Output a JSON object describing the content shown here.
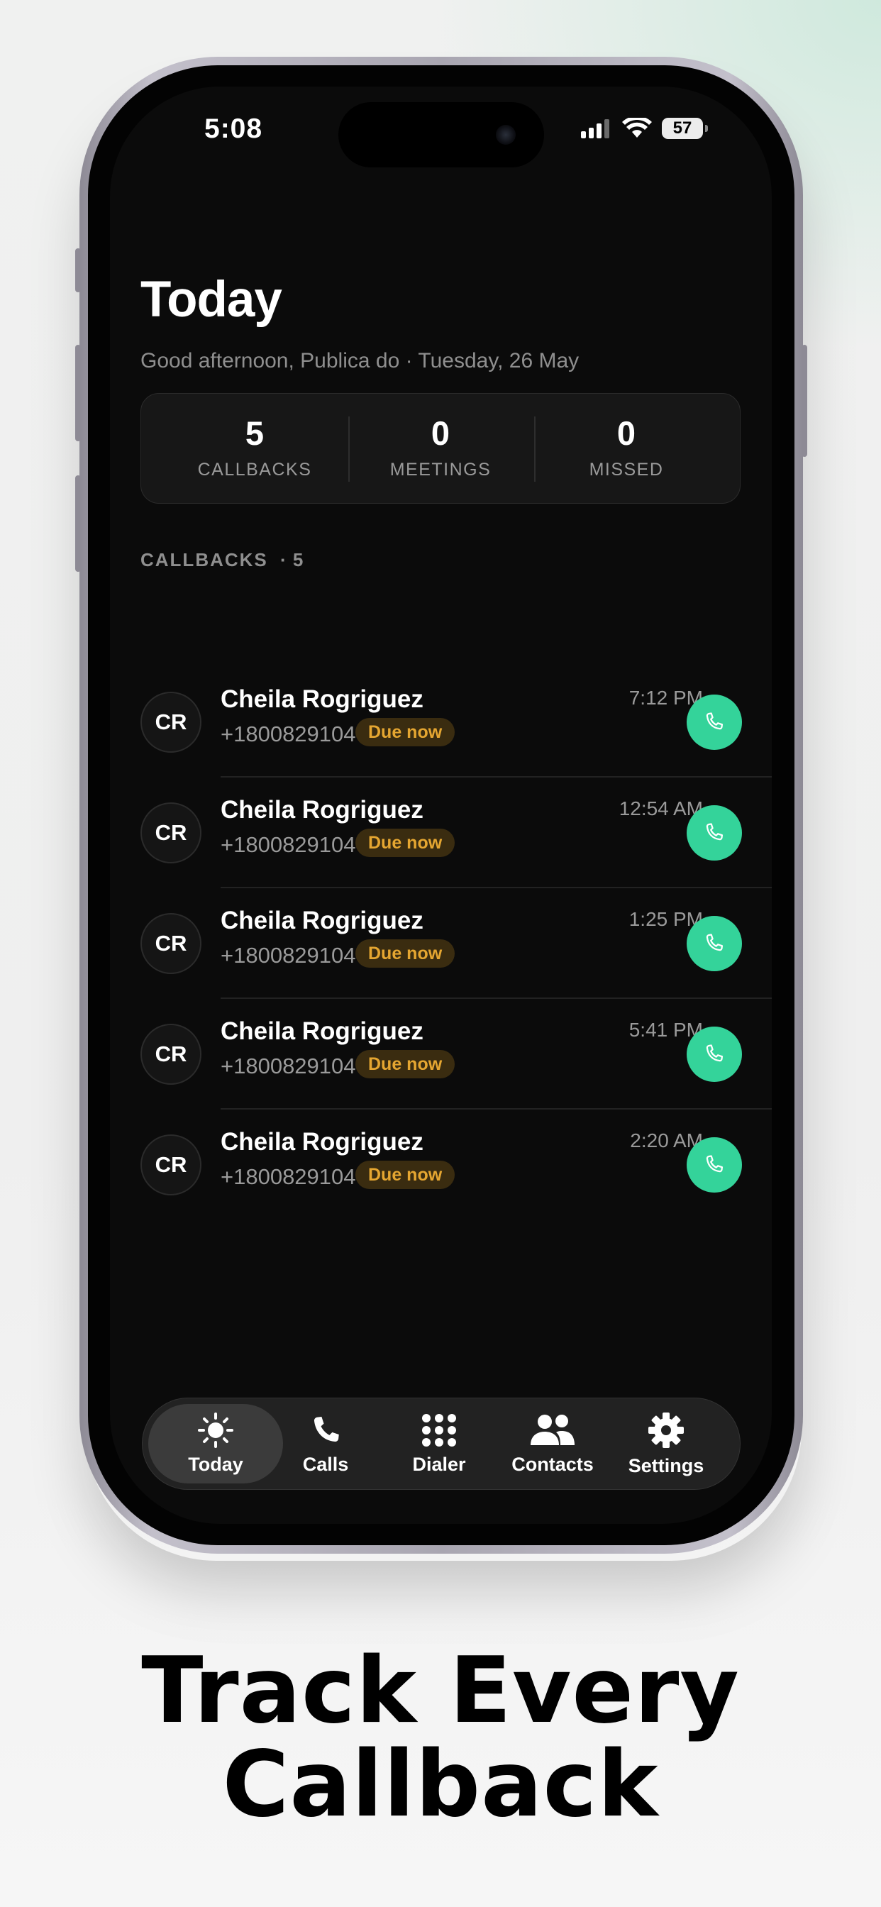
{
  "status_bar": {
    "time": "5:08",
    "battery": "57"
  },
  "header": {
    "title": "Today",
    "subtitle": "Good afternoon, Publica do · Tuesday, 26 May"
  },
  "stats": [
    {
      "value": "5",
      "label": "CALLBACKS"
    },
    {
      "value": "0",
      "label": "MEETINGS"
    },
    {
      "value": "0",
      "label": "MISSED"
    }
  ],
  "callbacks_section": {
    "label": "CALLBACKS",
    "count": "· 5"
  },
  "callbacks": [
    {
      "initials": "CR",
      "name": "Cheila Rogriguez",
      "phone": "+18008291040",
      "badge": "Due now",
      "time": "7:12 PM"
    },
    {
      "initials": "CR",
      "name": "Cheila Rogriguez",
      "phone": "+18008291040",
      "badge": "Due now",
      "time": "12:54 AM"
    },
    {
      "initials": "CR",
      "name": "Cheila Rogriguez",
      "phone": "+18008291040",
      "badge": "Due now",
      "time": "1:25 PM"
    },
    {
      "initials": "CR",
      "name": "Cheila Rogriguez",
      "phone": "+18008291040",
      "badge": "Due now",
      "time": "5:41 PM"
    },
    {
      "initials": "CR",
      "name": "Cheila Rogriguez",
      "phone": "+18008291040",
      "badge": "Due now",
      "time": "2:20 AM"
    }
  ],
  "tabs": [
    {
      "label": "Today",
      "icon": "sun-icon",
      "active": true
    },
    {
      "label": "Calls",
      "icon": "phone-icon",
      "active": false
    },
    {
      "label": "Dialer",
      "icon": "keypad-icon",
      "active": false
    },
    {
      "label": "Contacts",
      "icon": "people-icon",
      "active": false
    },
    {
      "label": "Settings",
      "icon": "gear-icon",
      "active": false
    }
  ],
  "headline": {
    "line1": "Track Every",
    "line2": "Callback"
  },
  "colors": {
    "accent_green": "#34d39a",
    "due_badge_text": "#e5a631",
    "due_badge_bg": "#3a2c10",
    "screen_bg": "#0b0b0b"
  }
}
